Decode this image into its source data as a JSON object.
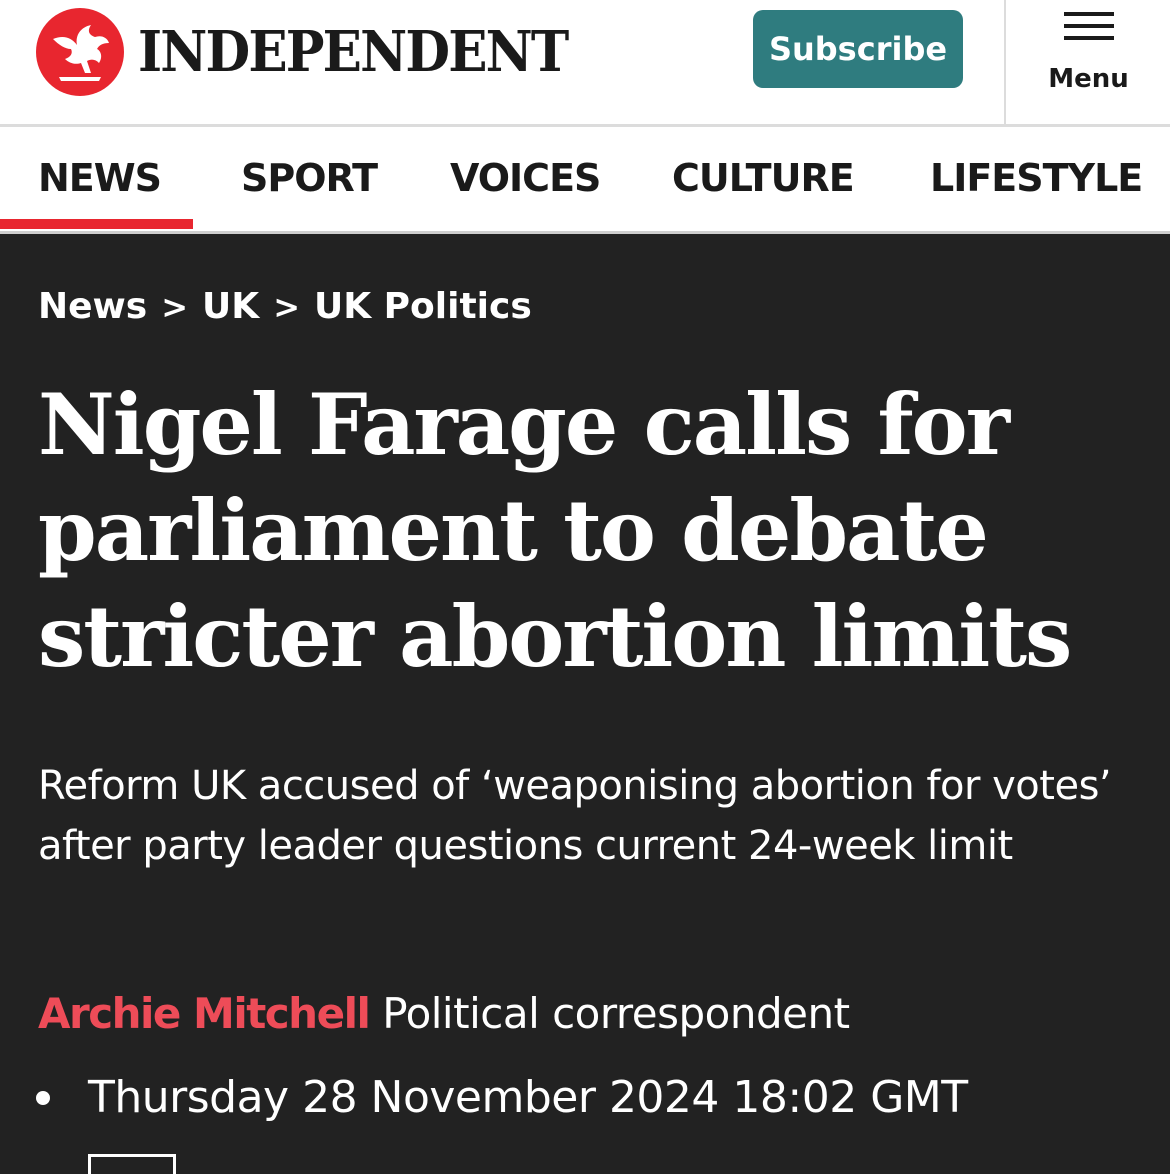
{
  "header": {
    "logo_text": "INDEPENDENT",
    "subscribe_label": "Subscribe",
    "menu_label": "Menu"
  },
  "nav": {
    "items": [
      {
        "label": "NEWS",
        "active": true
      },
      {
        "label": "SPORT",
        "active": false
      },
      {
        "label": "VOICES",
        "active": false
      },
      {
        "label": "CULTURE",
        "active": false
      },
      {
        "label": "LIFESTYLE",
        "active": false
      }
    ]
  },
  "breadcrumb": {
    "items": [
      "News",
      "UK",
      "UK Politics"
    ],
    "separator": ">"
  },
  "article": {
    "headline": "Nigel Farage calls for parliament to debate stricter abortion limits",
    "standfirst": "Reform UK accused of ‘weaponising abortion for votes’ after party leader questions current 24-week limit",
    "author": "Archie Mitchell",
    "author_role": "Political correspondent",
    "published": "Thursday 28 November 2024 18:02 GMT"
  },
  "colors": {
    "brand_red": "#e8262f",
    "subscribe_teal": "#2f7c7f",
    "author_red": "#ee4c58",
    "article_bg": "#222222"
  },
  "icons": {
    "logo": "eagle-logo-icon",
    "menu": "hamburger-menu-icon",
    "bullet": "bullet-dot-icon"
  }
}
